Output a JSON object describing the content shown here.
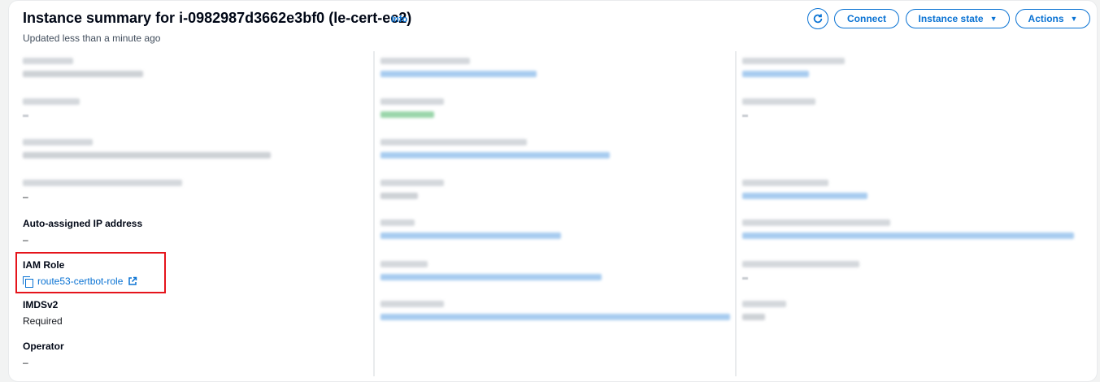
{
  "header": {
    "title": "Instance summary for i-0982987d3662e3bf0 (le-cert-ec2)",
    "info": "Info",
    "subtitle": "Updated less than a minute ago",
    "connect_label": "Connect",
    "instance_state_label": "Instance state",
    "actions_label": "Actions"
  },
  "fields": {
    "auto_ip": {
      "label": "Auto-assigned IP address",
      "value": "–"
    },
    "iam_role": {
      "label": "IAM Role",
      "value": "route53-certbot-role"
    },
    "imdsv2": {
      "label": "IMDSv2",
      "value": "Required"
    },
    "operator": {
      "label": "Operator",
      "value": "–"
    },
    "redacted_blank": {
      "value": "–"
    }
  },
  "colors": {
    "accent": "#0972d3",
    "highlight_box": "#e5141b"
  },
  "icons": {
    "refresh": "refresh-icon",
    "copy": "copy-icon",
    "external": "external-link-icon",
    "caret": "caret-down-icon"
  }
}
